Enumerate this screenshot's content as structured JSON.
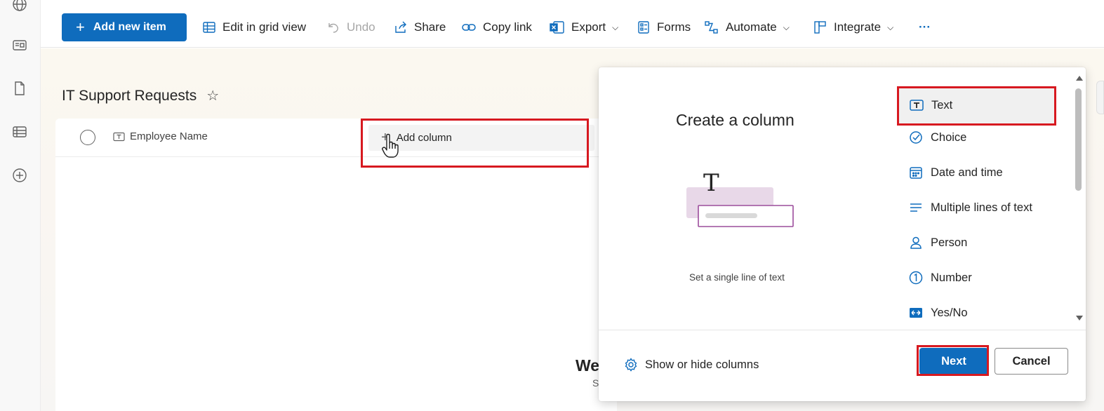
{
  "commandbar": {
    "add_new_item": "Add new item",
    "edit_grid": "Edit in grid view",
    "undo": "Undo",
    "share": "Share",
    "copy_link": "Copy link",
    "export": "Export",
    "forms": "Forms",
    "automate": "Automate",
    "integrate": "Integrate",
    "more": "···"
  },
  "list": {
    "title": "IT Support Requests",
    "star": "☆",
    "columns": [
      "Employee Name"
    ],
    "add_column": "Add column",
    "welcome_partial": "We",
    "welcome_sub_partial": "S"
  },
  "panel": {
    "title": "Create a column",
    "illustration_glyph": "T",
    "description": "Set a single line of text",
    "options": [
      {
        "label": "Text",
        "icon": "text-field-icon",
        "selected": true
      },
      {
        "label": "Choice",
        "icon": "choice-icon",
        "selected": false
      },
      {
        "label": "Date and time",
        "icon": "calendar-icon",
        "selected": false
      },
      {
        "label": "Multiple lines of text",
        "icon": "multiline-text-icon",
        "selected": false
      },
      {
        "label": "Person",
        "icon": "person-icon",
        "selected": false
      },
      {
        "label": "Number",
        "icon": "number-icon",
        "selected": false
      },
      {
        "label": "Yes/No",
        "icon": "yes-no-icon",
        "selected": false
      }
    ],
    "show_hide": "Show or hide columns",
    "next": "Next",
    "cancel": "Cancel"
  },
  "colors": {
    "brand_blue": "#0f6cbd",
    "highlight_red": "#d71920",
    "illustration_purple": "#9c4d9c",
    "illustration_pink": "#e8d8e8"
  }
}
